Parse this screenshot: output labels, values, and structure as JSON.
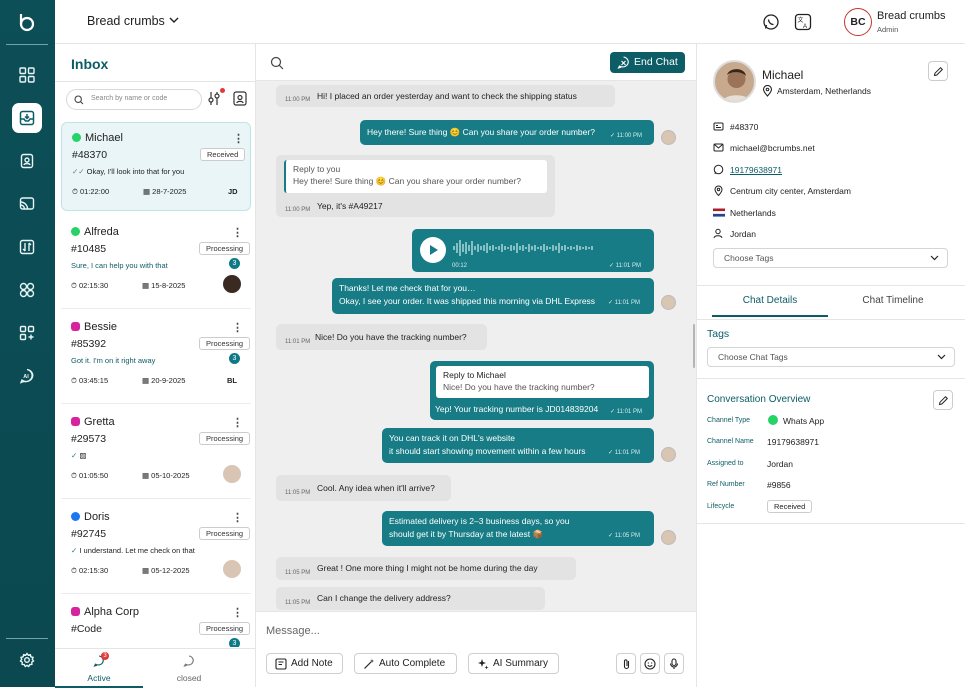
{
  "header": {
    "breadcrumb": "Bread crumbs",
    "user_initials": "BC",
    "user_name": "Bread crumbs",
    "user_role": "Admin"
  },
  "inbox": {
    "title": "Inbox",
    "search_placeholder": "Search by name or code",
    "conversations": [
      {
        "name": "Michael",
        "code": "#48370",
        "status": "Received",
        "preview": "Okay, I'll look into that for you",
        "time": "01:22:00",
        "date": "28-7-2025",
        "initials": "JD",
        "channel": "whatsapp"
      },
      {
        "name": "Alfreda",
        "code": "#10485",
        "status": "Processing",
        "preview": "Sure, I can help you with that",
        "count": "3",
        "time": "02:15:30",
        "date": "15-8-2025",
        "channel": "whatsapp"
      },
      {
        "name": "Bessie",
        "code": "#85392",
        "status": "Processing",
        "preview": "Got it. I'm on it right away",
        "count": "3",
        "time": "03:45:15",
        "date": "20-9-2025",
        "initials": "BL",
        "channel": "instagram"
      },
      {
        "name": "Gretta",
        "code": "#29573",
        "status": "Processing",
        "preview": "",
        "time": "01:05:50",
        "date": "05-10-2025",
        "channel": "instagram"
      },
      {
        "name": "Doris",
        "code": "#92745",
        "status": "Processing",
        "preview": "I understand. Let me check on that",
        "time": "02:15:30",
        "date": "05-12-2025",
        "channel": "messenger"
      },
      {
        "name": "Alpha Corp",
        "code": "#Code",
        "status": "Processing",
        "preview": "",
        "count": "3",
        "time": "",
        "date": "",
        "channel": "instagram"
      }
    ],
    "tab_active": "Active",
    "tab_closed": "closed",
    "active_badge": "3"
  },
  "chat": {
    "end_chat": "End Chat",
    "messages": [
      {
        "dir": "in",
        "time": "11:00 PM",
        "text": "Hi! I placed an order yesterday and want to check the shipping status"
      },
      {
        "dir": "out",
        "time": "11:00 PM",
        "text": "Hey there! Sure thing 😊 Can you share your order number?"
      },
      {
        "dir": "in",
        "time": "11:00 PM",
        "reply_to": "Reply to you",
        "reply_text": "Hey there! Sure thing 😊 Can you share your order number?",
        "text": "Yep, it's #A49217"
      },
      {
        "dir": "out",
        "type": "audio",
        "duration": "00:12",
        "time": "11:01 PM"
      },
      {
        "dir": "out",
        "time": "11:01 PM",
        "text": "Thanks! Let me check that for you…",
        "text2": "Okay, I see your order. It was shipped this morning via DHL Express"
      },
      {
        "dir": "in",
        "time": "11:01 PM",
        "text": "Nice! Do you have the tracking number?"
      },
      {
        "dir": "out",
        "time": "11:01 PM",
        "reply_to": "Reply to Michael",
        "reply_text": "Nice! Do you have the tracking number?",
        "text": "Yep! Your tracking number is JD014839204"
      },
      {
        "dir": "out",
        "time": "11:01 PM",
        "text": "You can track it on DHL's website",
        "text2": "it should start showing movement within a few hours"
      },
      {
        "dir": "in",
        "time": "11:05 PM",
        "text": "Cool. Any idea when it'll arrive?"
      },
      {
        "dir": "out",
        "time": "11:05 PM",
        "text": "Estimated delivery is 2–3 business days, so you",
        "text2": "should get it by Thursday at the latest 📦"
      },
      {
        "dir": "in",
        "time": "11:05 PM",
        "text": "Great ! One more thing I might not be home during the day"
      },
      {
        "dir": "in",
        "time": "11:05 PM",
        "text": "Can I change the delivery address?"
      }
    ],
    "composer_placeholder": "Message...",
    "add_note": "Add Note",
    "auto_complete": "Auto Complete",
    "ai_summary": "AI Summary"
  },
  "profile": {
    "name": "Michael",
    "location": "Amsterdam, Netherlands",
    "code": "#48370",
    "email": "michael@bcrumbs.net",
    "phone": "19179638971",
    "address": "Centrum city center, Amsterdam",
    "country": "Netherlands",
    "agent": "Jordan",
    "choose_tags": "Choose Tags",
    "tab_details": "Chat Details",
    "tab_timeline": "Chat Timeline",
    "tags_label": "Tags",
    "choose_chat_tags": "Choose Chat Tags",
    "overview_title": "Conversation Overview",
    "overview": {
      "channel_type_label": "Channel Type",
      "channel_type": "Whats App",
      "channel_name_label": "Channel Name",
      "channel_name": "19179638971",
      "assigned_label": "Assigned to",
      "assigned": "Jordan",
      "ref_label": "Ref Number",
      "ref": "#9856",
      "lifecycle_label": "Lifecycle",
      "lifecycle": "Received"
    }
  },
  "colors": {
    "primary": "#0d5d66",
    "bubble_out": "#177c85",
    "bubble_in": "#e3e3e3",
    "whatsapp": "#25d366",
    "instagram": "#d6249f",
    "messenger": "#1877f2"
  }
}
